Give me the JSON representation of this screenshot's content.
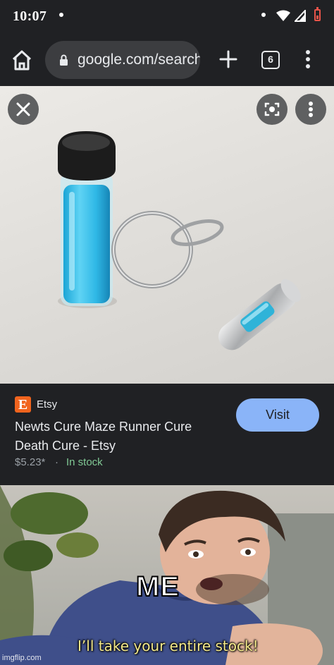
{
  "status_bar": {
    "time": "10:07"
  },
  "toolbar": {
    "url": "google.com/search",
    "tab_count": "6"
  },
  "image_viewer": {
    "buttons": [
      "close-icon",
      "lens-icon",
      "more-vert-icon"
    ],
    "image": "blue liquid vial with black cap beside a silver vial keychain"
  },
  "result": {
    "source": "Etsy",
    "logo_letter": "E",
    "title": "Newts Cure Maze Runner Cure Death Cure - Etsy",
    "price": "$5.23*",
    "separator": "·",
    "stock": "In stock",
    "visit_label": "Visit"
  },
  "meme": {
    "label": "ME",
    "caption": "I’ll take your entire stock!",
    "watermark": "imgflip.com"
  },
  "colors": {
    "accent": "#8ab4f8",
    "in_stock": "#81c995",
    "etsy": "#f1641e",
    "battery": "#e9544a",
    "caption": "#f4e98a"
  }
}
